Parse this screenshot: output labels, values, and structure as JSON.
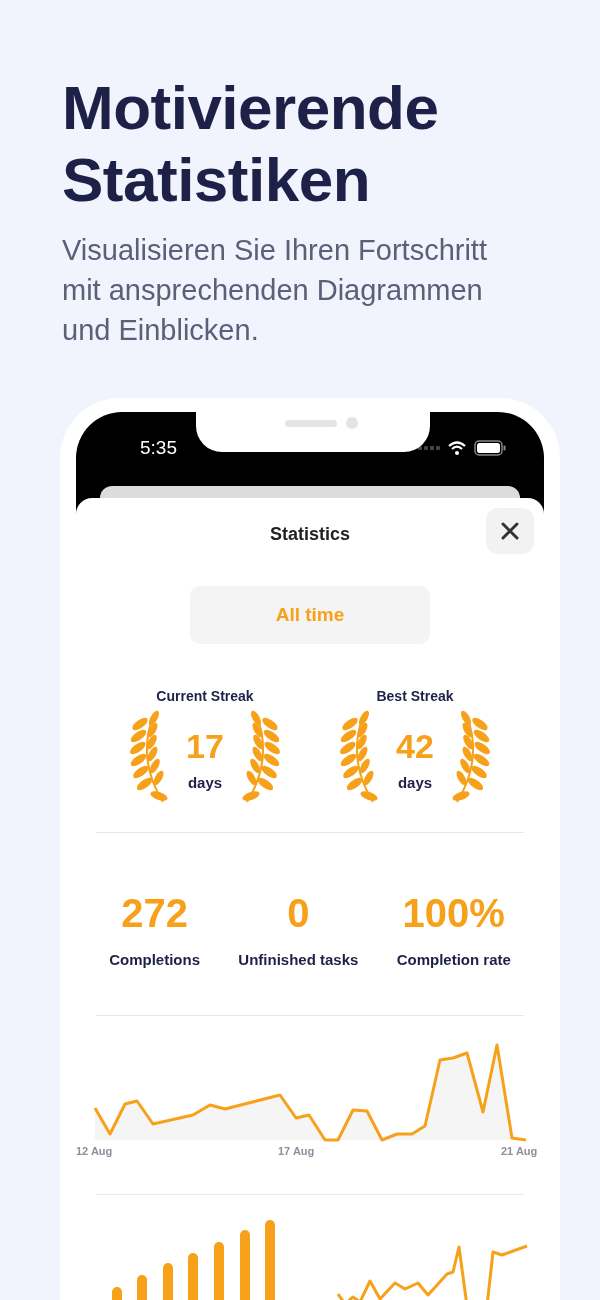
{
  "headline": "Motivierende Statistiken",
  "subtitle": "Visualisieren Sie Ihren Fortschritt mit ansprechenden Diagrammen und Einblicken.",
  "status_bar": {
    "time": "5:35"
  },
  "sheet": {
    "title": "Statistics"
  },
  "period_filter": {
    "label": "All time"
  },
  "streaks": [
    {
      "label": "Current Streak",
      "value": "17",
      "unit": "days"
    },
    {
      "label": "Best Streak",
      "value": "42",
      "unit": "days"
    }
  ],
  "totals": [
    {
      "value": "272",
      "label": "Completions"
    },
    {
      "value": "0",
      "label": "Unfinished tasks"
    },
    {
      "value": "100%",
      "label": "Completion rate"
    }
  ],
  "line_chart": {
    "x_labels": [
      "12 Aug",
      "17 Aug",
      "21 Aug"
    ]
  }
}
